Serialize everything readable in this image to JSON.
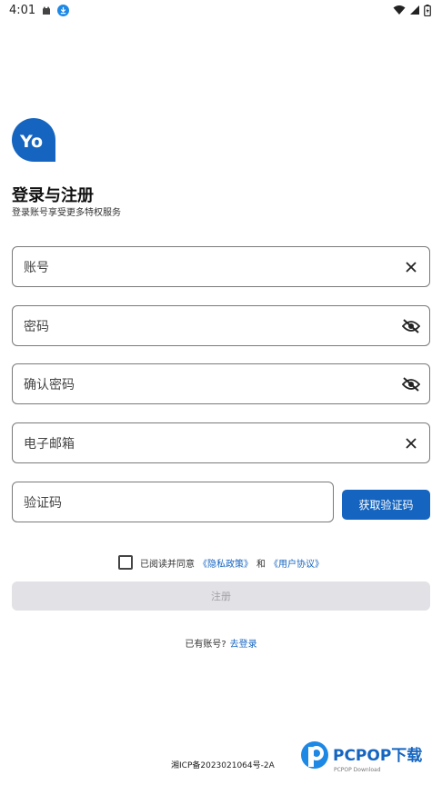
{
  "status_bar": {
    "time": "4:01"
  },
  "logo": {
    "text": "Yo",
    "color": "#1565c0"
  },
  "header": {
    "title": "登录与注册",
    "subtitle": "登录账号享受更多特权服务"
  },
  "fields": {
    "account": {
      "label": "账号",
      "trailing_icon": "clear-icon"
    },
    "password": {
      "label": "密码",
      "trailing_icon": "eye-off-icon"
    },
    "confirm_password": {
      "label": "确认密码",
      "trailing_icon": "eye-off-icon"
    },
    "email": {
      "label": "电子邮箱",
      "trailing_icon": "clear-icon"
    },
    "code": {
      "label": "验证码"
    }
  },
  "get_code_button": {
    "label": "获取验证码",
    "color": "#1565c0"
  },
  "agreement": {
    "prefix": "已阅读并同意",
    "privacy": "《隐私政策》",
    "and": "和",
    "terms": "《用户协议》",
    "checked": false
  },
  "register_button": {
    "label": "注册"
  },
  "login_prompt": {
    "text": "已有账号?",
    "link": "去登录"
  },
  "footer": {
    "icp": "湘ICP备2023021064号-2A"
  },
  "watermark": {
    "brand": "PCPOP下载",
    "sub": "PCPOP Download"
  }
}
